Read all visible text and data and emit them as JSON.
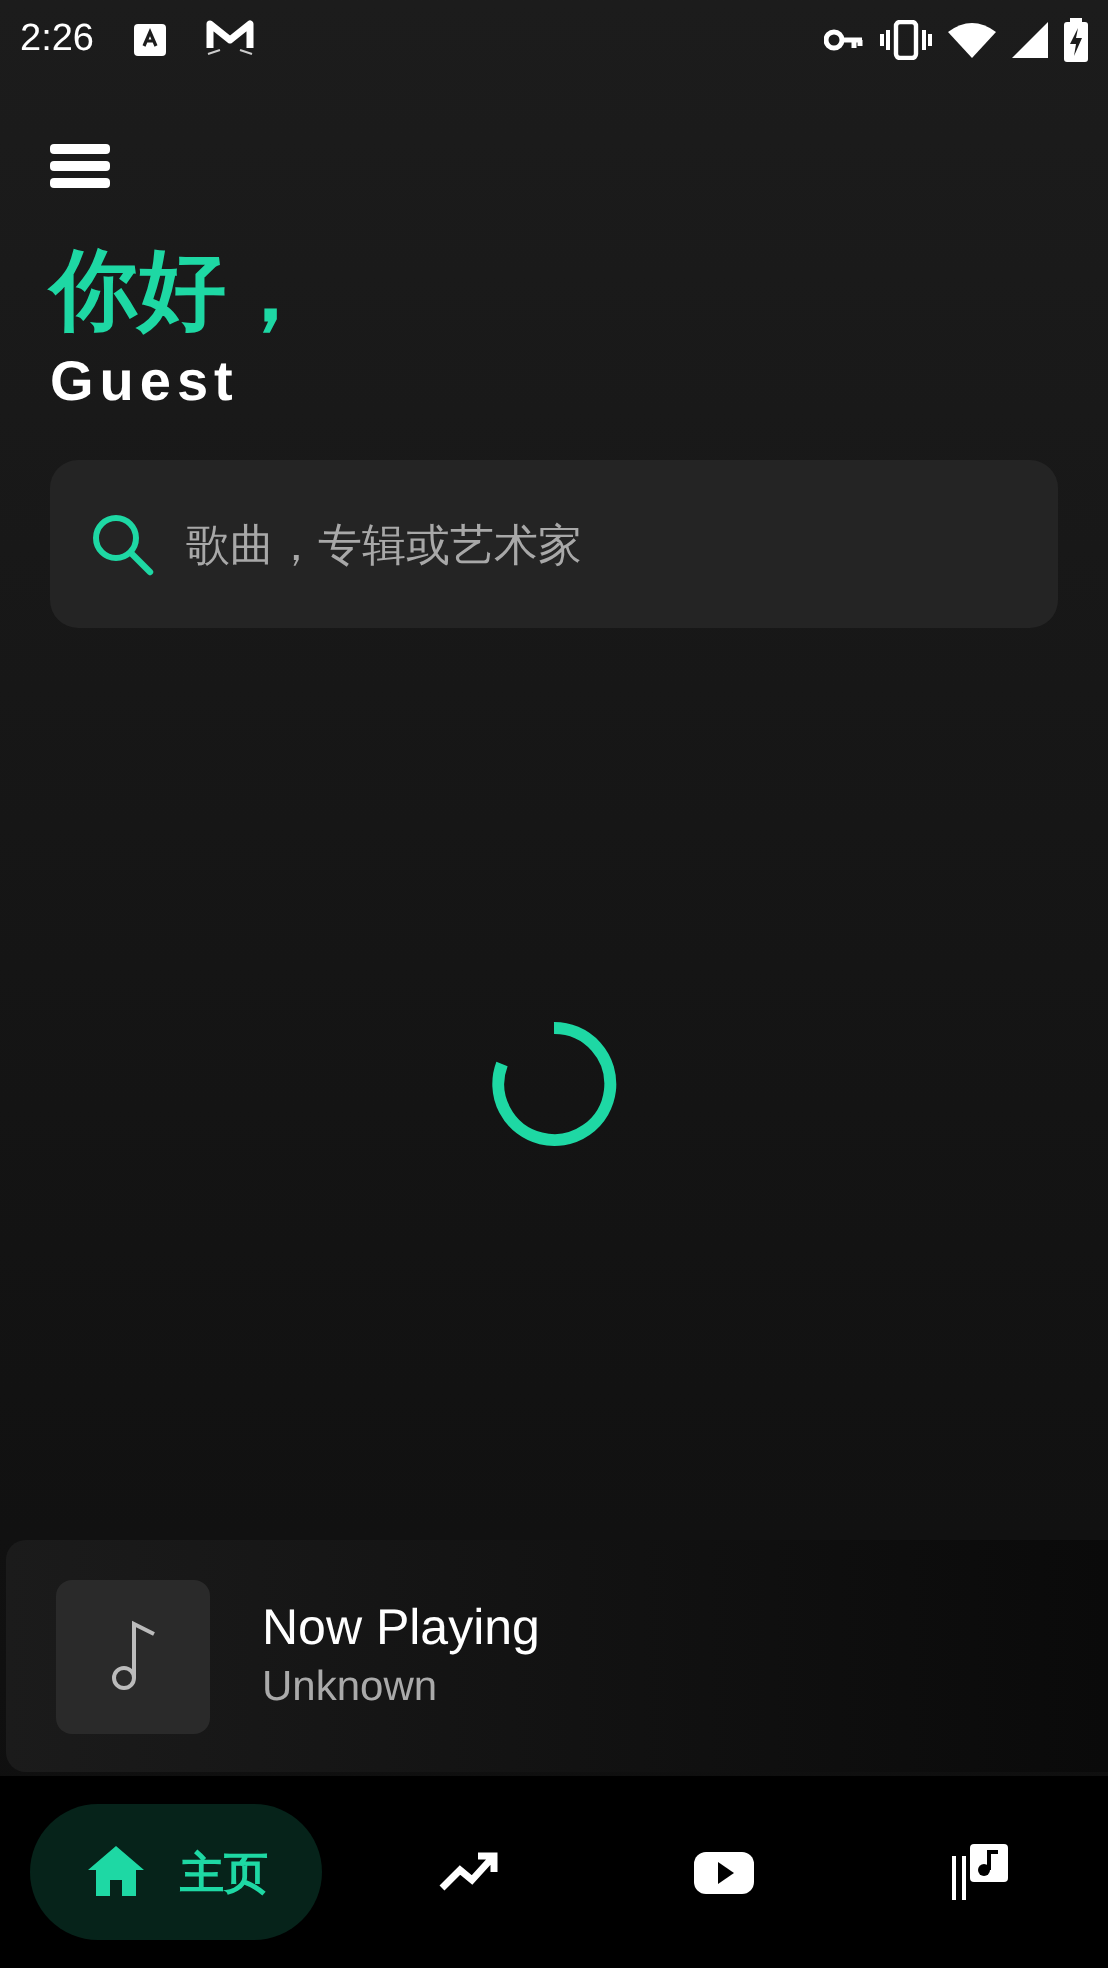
{
  "status_bar": {
    "time": "2:26"
  },
  "greeting": {
    "title": "你好，",
    "name": "Guest"
  },
  "search": {
    "placeholder": "歌曲，专辑或艺术家"
  },
  "now_playing": {
    "title": "Now Playing",
    "artist": "Unknown"
  },
  "nav": [
    {
      "kind": "home",
      "selected": true,
      "label": "主页"
    },
    {
      "kind": "trending",
      "selected": false
    },
    {
      "kind": "video",
      "selected": false
    },
    {
      "kind": "library",
      "selected": false
    }
  ]
}
